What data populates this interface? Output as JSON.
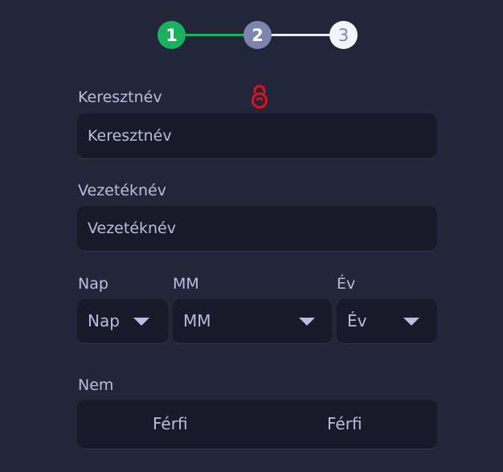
{
  "stepper": {
    "steps": [
      {
        "number": "1",
        "state": "completed",
        "color": "#1bb05c"
      },
      {
        "number": "2",
        "state": "current",
        "color": "#7d84ad"
      },
      {
        "number": "3",
        "state": "upcoming",
        "color": "#f3f4fa"
      }
    ]
  },
  "first_name": {
    "label": "Keresztnév",
    "placeholder": "Keresztnév"
  },
  "last_name": {
    "label": "Vezetéknév",
    "placeholder": "Vezetéknév"
  },
  "birthdate": {
    "day": {
      "label": "Nap",
      "value": "Nap"
    },
    "month": {
      "label": "MM",
      "value": "MM"
    },
    "year": {
      "label": "Év",
      "value": "Év"
    }
  },
  "gender": {
    "label": "Nem",
    "options": [
      "Férfi",
      "Férfi"
    ]
  },
  "icons": {
    "lock": "lock-icon",
    "caret": "chevron-down-icon"
  },
  "colors": {
    "background": "#23263a",
    "field": "#181a29",
    "success": "#1bb05c",
    "lock": "#e0111e"
  }
}
